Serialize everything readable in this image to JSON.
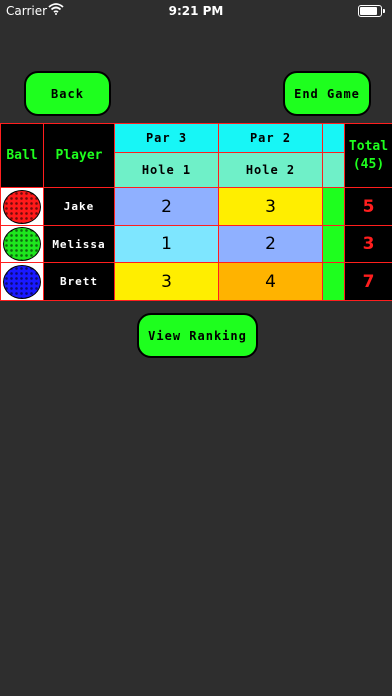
{
  "status": {
    "carrier": "Carrier",
    "time": "9:21 PM",
    "battery_level": 0.95
  },
  "buttons": {
    "back": "Back",
    "end_game": "End Game",
    "view_ranking": "View Ranking"
  },
  "table": {
    "ball_header": "Ball",
    "player_header": "Player",
    "par": [
      "Par 3",
      "Par 2"
    ],
    "holes": [
      "Hole 1",
      "Hole 2"
    ],
    "total_header": "Total",
    "total_par": "(45)",
    "rows": [
      {
        "ball_color": "#ff1a1a",
        "name": "Jake",
        "scores": [
          "2",
          "3"
        ],
        "score_colors": [
          "#8fb0ff",
          "#ffee00"
        ],
        "total": "5"
      },
      {
        "ball_color": "#1ee61e",
        "name": "Melissa",
        "scores": [
          "1",
          "2"
        ],
        "score_colors": [
          "#7ee6ff",
          "#8fb0ff"
        ],
        "total": "3"
      },
      {
        "ball_color": "#1a1aff",
        "name": "Brett",
        "scores": [
          "3",
          "4"
        ],
        "score_colors": [
          "#ffee00",
          "#ffb300"
        ],
        "total": "7"
      }
    ]
  },
  "icons": {
    "wifi": "wifi-icon",
    "battery": "battery-icon",
    "ball": "golf-ball-icon"
  },
  "colors": {
    "background": "#2e2e2e",
    "accent_green": "#1eff1e",
    "grid_red": "#ff1e1e",
    "par_cyan": "#17f6f6",
    "hole_teal": "#6ff0c8"
  }
}
